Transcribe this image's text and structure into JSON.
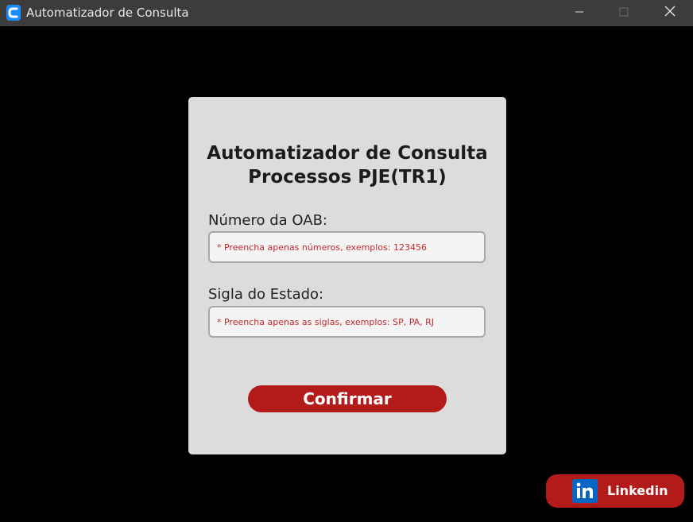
{
  "window": {
    "title": "Automatizador de Consulta",
    "app_icon": "app-logo-icon",
    "controls": {
      "minimize_icon": "minimize-icon",
      "maximize_icon": "maximize-icon",
      "close_icon": "close-icon"
    }
  },
  "form": {
    "title_line1": "Automatizador de Consulta",
    "title_line2": "Processos PJE(TR1)",
    "oab_label": "Número da OAB:",
    "oab_placeholder": "* Preencha apenas números, exemplos: 123456",
    "oab_value": "",
    "state_label": "Sigla do Estado:",
    "state_placeholder": "* Preencha apenas as siglas, exemplos: SP, PA, RJ",
    "state_value": "",
    "confirm_label": "Confirmar"
  },
  "linkedin": {
    "label": "Linkedin",
    "icon": "linkedin-icon"
  },
  "colors": {
    "background": "#000000",
    "titlebar": "#3c3c3c",
    "card": "#dcdcdc",
    "accent_red": "#b31a1a",
    "placeholder_red": "#c0282c",
    "linkedin_blue": "#0a66c2"
  }
}
